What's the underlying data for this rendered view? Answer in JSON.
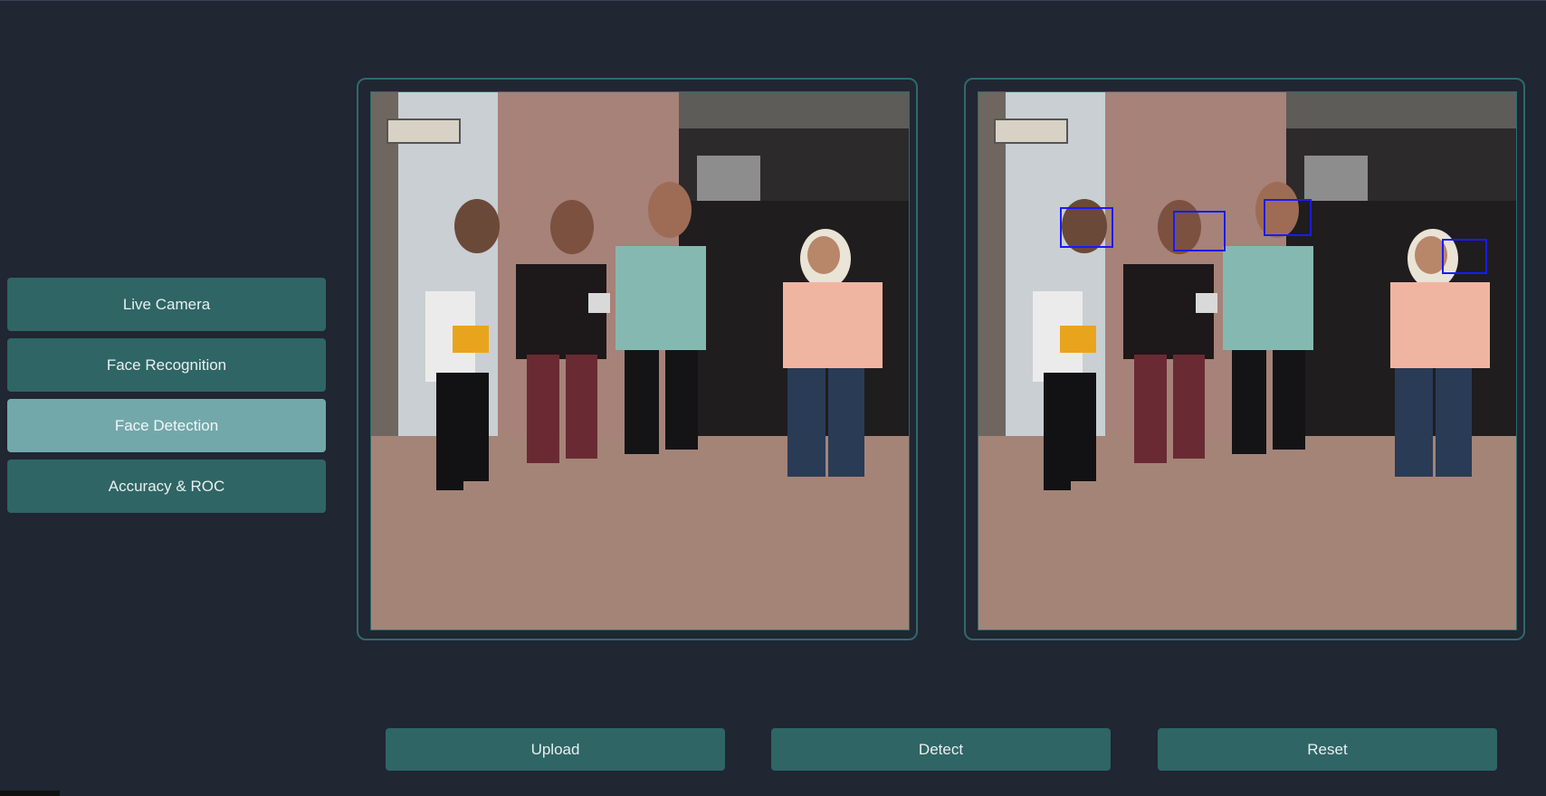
{
  "sidebar": {
    "items": [
      {
        "label": "Live Camera",
        "active": false
      },
      {
        "label": "Face Recognition",
        "active": false
      },
      {
        "label": "Face Detection",
        "active": true
      },
      {
        "label": "Accuracy & ROC",
        "active": false
      }
    ]
  },
  "panels": {
    "input": {
      "content": "group-photo"
    },
    "output": {
      "content": "group-photo-with-face-boxes",
      "detected_faces": 4
    }
  },
  "actions": {
    "upload_label": "Upload",
    "detect_label": "Detect",
    "reset_label": "Reset"
  },
  "colors": {
    "background": "#202632",
    "button": "#2f6565",
    "button_active": "#73a8ab",
    "panel_border": "#2f6a6a",
    "detection_box": "#1a1aff"
  }
}
